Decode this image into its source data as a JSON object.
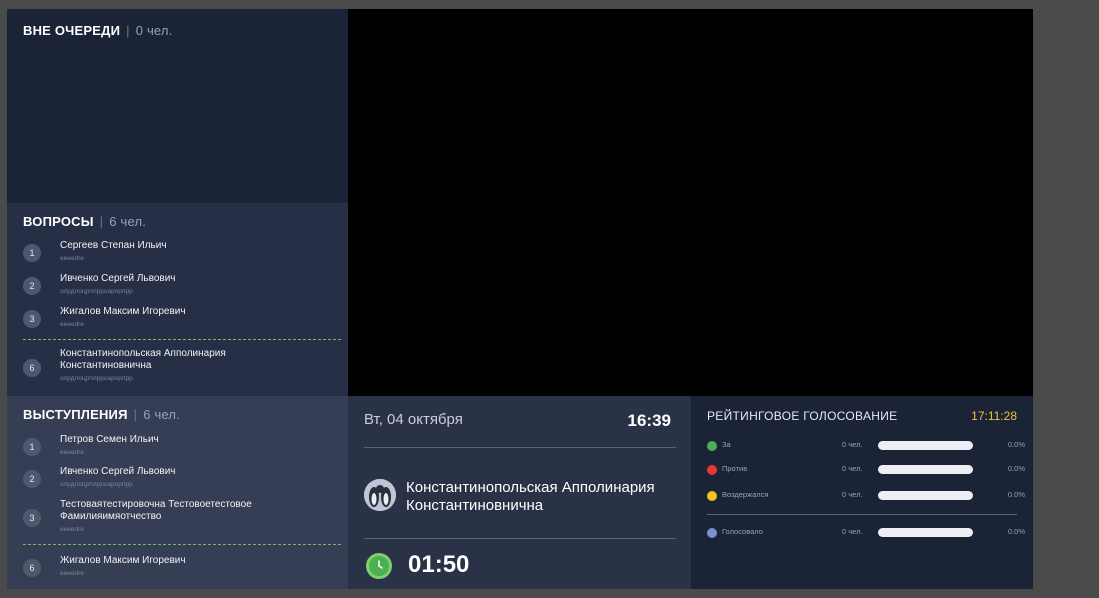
{
  "priority": {
    "title": "ВНЕ ОЧЕРЕДИ",
    "count": "0 чел."
  },
  "questions": {
    "title": "ВОПРОСЫ",
    "count": "6 чел.",
    "items": [
      {
        "num": "1",
        "name": "Сергеев Степан Ильич",
        "sub": "eeeedre"
      },
      {
        "num": "2",
        "name": "Ивченко Сергей Львович",
        "sub": "олрдлоцрплрроарорпрр"
      },
      {
        "num": "3",
        "name": "Жигалов Максим Игоревич",
        "sub": "eeeedre"
      },
      {
        "num": "6",
        "name": "Константинопольская Апполинария Константиновнична",
        "sub": "олрдлоцрплрроарорпрр"
      }
    ]
  },
  "speeches": {
    "title": "ВЫСТУПЛЕНИЯ",
    "count": "6 чел.",
    "items": [
      {
        "num": "1",
        "name": "Петров Семен Ильич",
        "sub": "eeeedre"
      },
      {
        "num": "2",
        "name": "Ивченко Сергей Львович",
        "sub": "олрдлоцрплрроарорпрр"
      },
      {
        "num": "3",
        "name": "Тестоваятестировочна Тестовоетестовое Фамилияимяотчество",
        "sub": "eeeedre"
      },
      {
        "num": "6",
        "name": "Жигалов Максим Игоревич",
        "sub": "eeeedre"
      }
    ]
  },
  "clock": {
    "date": "Вт, 04 октября",
    "time": "16:39",
    "speaker": "Константинопольская Апполинария Константиновнична",
    "timer": "01:50"
  },
  "vote": {
    "title": "РЕЙТИНГОВОЕ ГОЛОСОВАНИЕ",
    "clock": "17:11:28",
    "rows": [
      {
        "label": "За",
        "count": "0 чел.",
        "pct": "0.0%",
        "color": "#4caf50"
      },
      {
        "label": "Против",
        "count": "0 чел.",
        "pct": "0.0%",
        "color": "#e53935"
      },
      {
        "label": "Воздержался",
        "count": "0 чел.",
        "pct": "0.0%",
        "color": "#f5c518"
      },
      {
        "label": "Голосовало",
        "count": "0 чел.",
        "pct": "0.0%",
        "color": "#7b8fd1"
      }
    ]
  }
}
